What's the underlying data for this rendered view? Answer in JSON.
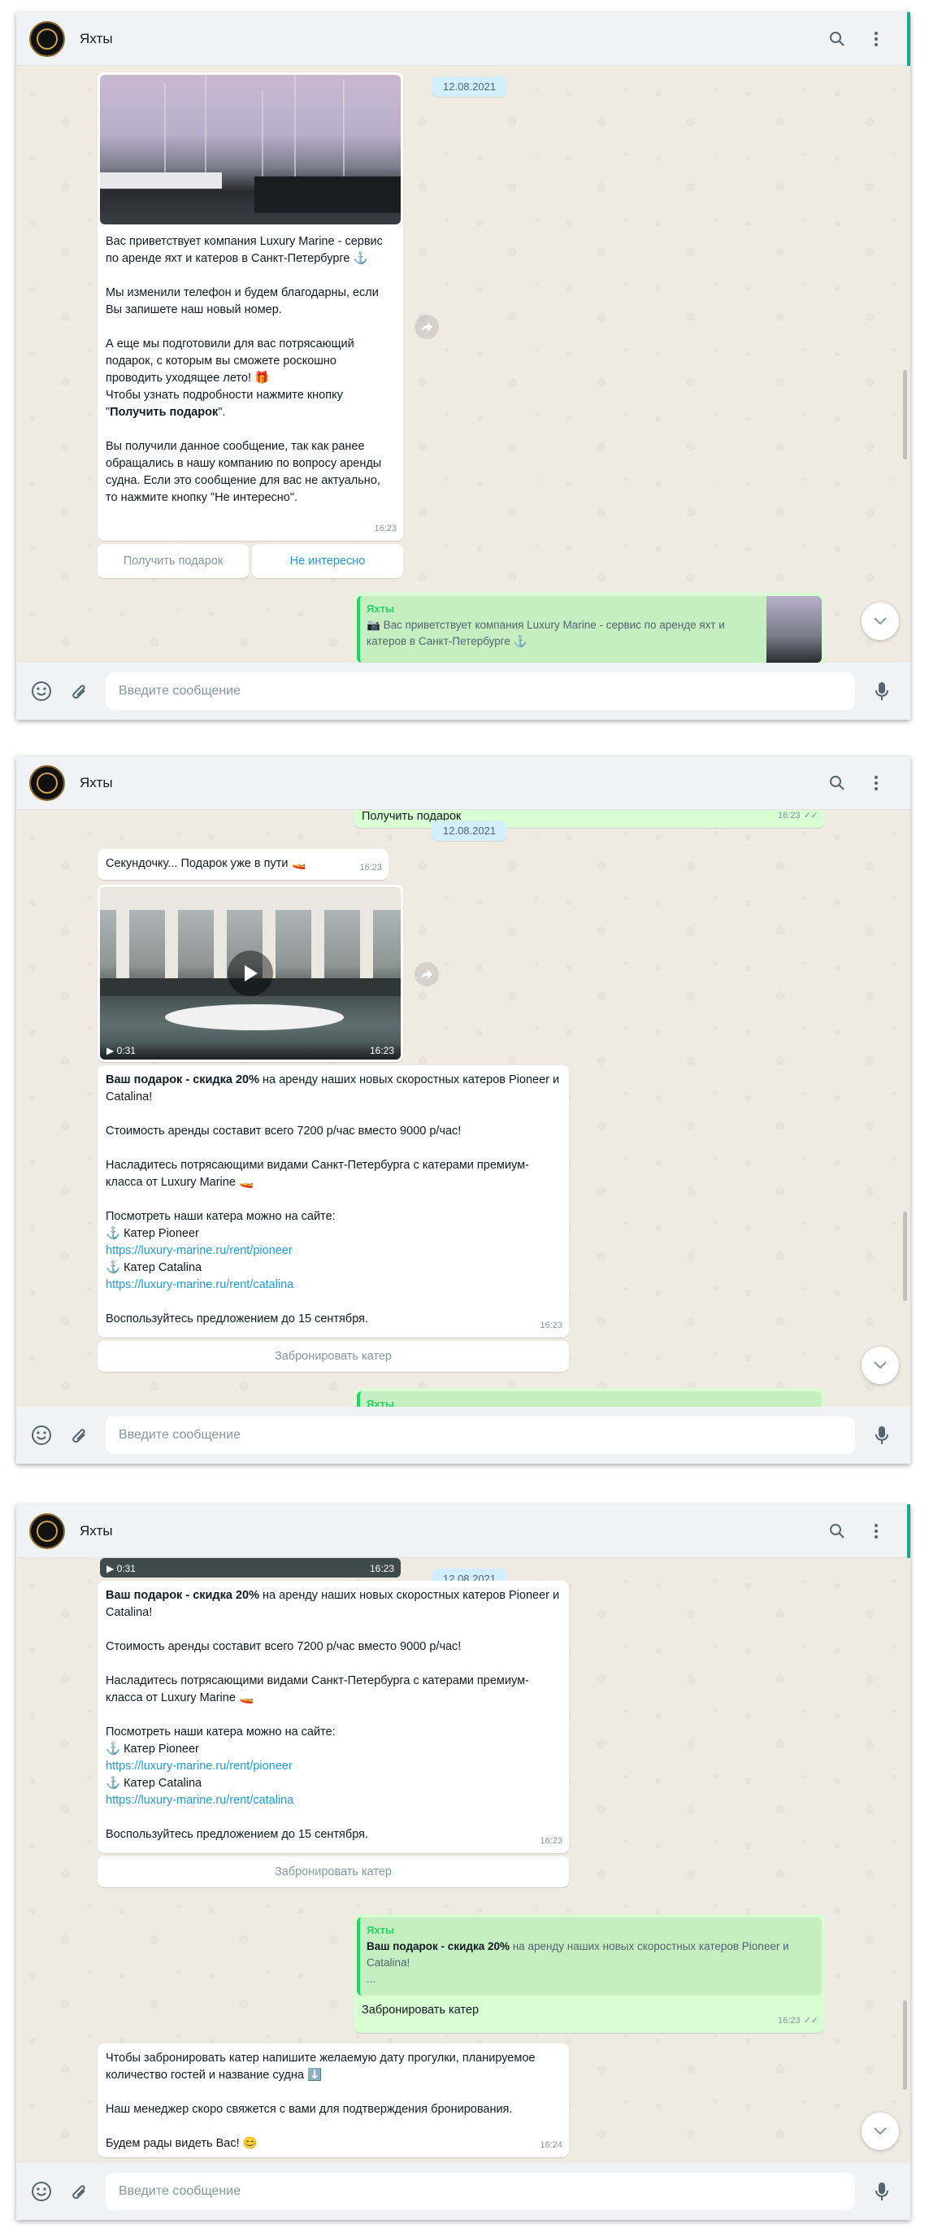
{
  "chat": {
    "name": "Яхты",
    "input_placeholder": "Введите сообщение",
    "date_label": "12.08.2021"
  },
  "messages": {
    "intro": {
      "text_parts": [
        "Вас приветствует компания Luxury Marine - сервис по аренде яхт и катеров в Санкт-Петербурге ⚓\n\nМы изменили телефон и будем благодарны, если Вы запишете наш новый номер.\n\nА еще мы подготовили для вас потрясающий подарок, с которым вы сможете роскошно проводить уходящее лето! 🎁\nЧтобы узнать подробности нажмите кнопку\n\"",
        "Получить подарок",
        "\".\n\nВы получили данное сообщение, так как ранее обращались в нашу компанию по вопросу аренды судна. Если это сообщение для вас не актуально, то нажмите кнопку \"Не интересно\"."
      ],
      "time": "16:23",
      "buttons": [
        "Получить подарок",
        "Не интересно"
      ]
    },
    "reply_quote": {
      "name": "Яхты",
      "text": "Вас приветствует компания Luxury Marine - сервис по аренде яхт и катеров в Санкт-Петербурге ⚓"
    },
    "sent_get_gift": {
      "text": "Получить подарок",
      "time": "16:23"
    },
    "wait": {
      "text": "Секундочку... Подарок уже в пути 🚤",
      "time": "16:23"
    },
    "video": {
      "duration": "0:31",
      "time": "16:23"
    },
    "offer": {
      "bold": "Ваш подарок - скидка 20%",
      "line1_rest": " на аренду наших новых скоростных катеров Pioneer и Catalina!",
      "price": "Стоимость аренды составит всего 7200 р/час вместо 9000 р/час!",
      "enjoy": "Насладитесь потрясающими видами Санкт-Петербурга с катерами премиум-класса от Luxury Marine 🚤",
      "see": "Посмотреть наши катера можно на сайте:",
      "pioneer_label": "⚓ Катер Pioneer",
      "pioneer_link": "https://luxury-marine.ru/rent/pioneer",
      "catalina_label": "⚓ Катер Catalina",
      "catalina_link": "https://luxury-marine.ru/rent/catalina",
      "until": "Воспользуйтесь предложением до 15 сентября.",
      "time": "16:23",
      "button": "Забронировать катер"
    },
    "reply2": {
      "name": "Яхты",
      "bold": "Ваш подарок - скидка 20%",
      "rest": " на аренду наших новых скоростных катеров Pioneer и Catalina!",
      "ellipsis": "...",
      "text": "Забронировать катер",
      "time": "16:23"
    },
    "final": {
      "p1": "Чтобы забронировать катер напишите желаемую дату прогулки, планируемое количество гостей и название судна ⬇️",
      "p2": "Наш менеджер скоро свяжется с вами для подтверждения бронирования.",
      "p3": "Будем рады видеть Вас! 😊",
      "time": "16:24"
    }
  }
}
